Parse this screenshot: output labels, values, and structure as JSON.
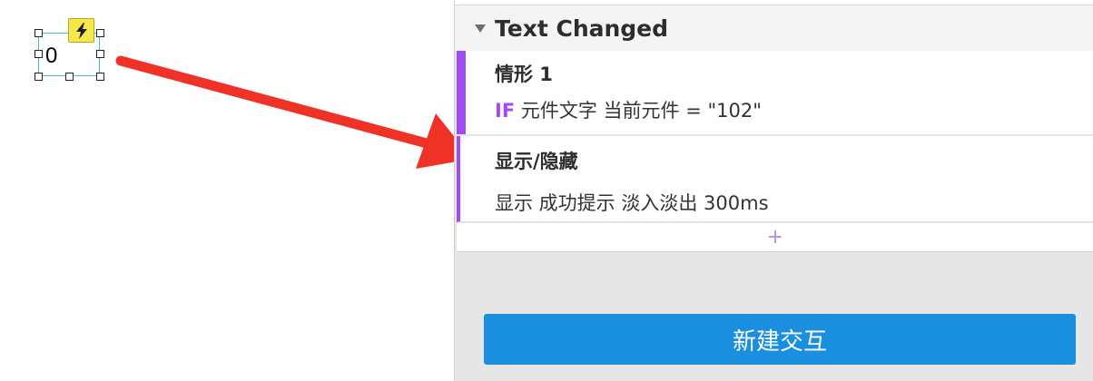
{
  "canvas": {
    "widget_text": "0"
  },
  "panel": {
    "event_title": "Text Changed",
    "case": {
      "name": "情形 1",
      "condition_keyword": "IF",
      "condition_text": "元件文字 当前元件 = \"102\""
    },
    "action": {
      "title": "显示/隐藏",
      "description": "显示 成功提示 淡入淡出 300ms"
    },
    "add_symbol": "+",
    "new_interaction_label": "新建交互"
  },
  "colors": {
    "accent_purple": "#a24bf5",
    "button_blue": "#1a8fe0",
    "annotation_red": "#f03226",
    "selection_teal": "#3cc8b8",
    "event_badge_yellow": "#f6e84a"
  }
}
